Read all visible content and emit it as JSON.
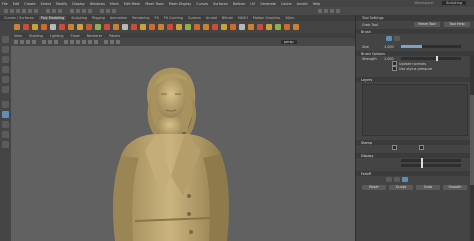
{
  "menubar": {
    "items": [
      "File",
      "Edit",
      "Create",
      "Select",
      "Modify",
      "Display",
      "Windows",
      "Mesh",
      "Edit Mesh",
      "Mesh Tools",
      "Mesh Display",
      "Curves",
      "Surfaces",
      "Deform",
      "UV",
      "Generate",
      "Cache",
      "Arnold",
      "Help"
    ],
    "right_label": "Workspace:",
    "workspace": "Sculpting"
  },
  "shelf": {
    "tabs": [
      "Curves / Surfaces",
      "Poly Modeling",
      "Sculpting",
      "Rigging",
      "Animation",
      "Rendering",
      "FX",
      "FX Caching",
      "Custom",
      "Arnold",
      "Bifrost",
      "MASH",
      "Motion Graphics",
      "XGen"
    ],
    "active_tab": "Poly Modeling",
    "icon_colors": [
      "#c9832f",
      "#d04a3a",
      "#c9a23a",
      "#d06a2a",
      "#b8b8b8",
      "#d04a3a",
      "#c9832f",
      "#d0a040",
      "#c95a2a",
      "#8fb04a",
      "#d04a3a",
      "#c9832f",
      "#b8b8b8",
      "#d04a3a",
      "#c9a23a",
      "#d06a2a",
      "#c9832f",
      "#d04a3a",
      "#c9a23a",
      "#8fb04a",
      "#d06a2a",
      "#c9832f",
      "#d04a3a",
      "#c9a23a",
      "#d06a2a",
      "#b8b8b8",
      "#c9832f",
      "#d04a3a",
      "#c9a23a",
      "#8fb04a",
      "#d06a2a",
      "#c9832f"
    ]
  },
  "viewport": {
    "panel_menu": [
      "View",
      "Shading",
      "Lighting",
      "Show",
      "Renderer",
      "Panels"
    ],
    "camera_label": "persp",
    "background": "#616161",
    "figure_color": "#c8b07a",
    "figure_shadow": "#9a8555"
  },
  "right_panel": {
    "header": "Tool Settings",
    "tool_name": "Grab Tool",
    "reset_label": "Reset Tool",
    "help_label": "Tool Help",
    "sections": {
      "brush": "Brush",
      "brush_options": "Brush Options",
      "layers": "Layers",
      "stamp": "Stamp",
      "display": "Display",
      "falloff": "Falloff"
    },
    "fields": {
      "size": "Size",
      "strength": "Strength",
      "size_value": "1.000",
      "strength_value": "1.000",
      "option1": "Update normals",
      "option2": "Use stylus pressure",
      "buttons": [
        "Reset",
        "Sculpt",
        "Grab",
        "Smooth"
      ]
    },
    "slider_size": 0.35,
    "slider_strength": 0.6
  }
}
